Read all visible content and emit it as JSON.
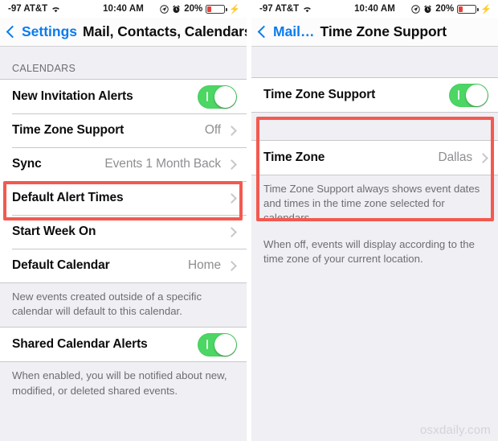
{
  "status_bar": {
    "carrier": "-97 AT&T",
    "wifi_icon": "wifi-icon",
    "time": "10:40 AM",
    "location_icon": "location-arrow-icon",
    "alarm_icon": "alarm-clock-icon",
    "battery_percent": "20%",
    "battery_level": 20,
    "charging_icon": "lightning-bolt-icon"
  },
  "left_screen": {
    "nav": {
      "back_label": "Settings",
      "back_icon": "chevron-left-icon",
      "title": "Mail, Contacts, Calendars"
    },
    "section_header": "CALENDARS",
    "rows": [
      {
        "label": "New Invitation Alerts",
        "control": "toggle",
        "toggle_on": true
      },
      {
        "label": "Time Zone Support",
        "value": "Off",
        "control": "disclosure",
        "highlighted": true
      },
      {
        "label": "Sync",
        "value": "Events 1 Month Back",
        "control": "disclosure"
      },
      {
        "label": "Default Alert Times",
        "value": "",
        "control": "disclosure"
      },
      {
        "label": "Start Week On",
        "value": "",
        "control": "disclosure"
      },
      {
        "label": "Default Calendar",
        "value": "Home",
        "control": "disclosure"
      }
    ],
    "footnote_1": "New events created outside of a specific calendar will default to this calendar.",
    "shared_row": {
      "label": "Shared Calendar Alerts",
      "control": "toggle",
      "toggle_on": true
    },
    "footnote_2": "When enabled, you will be notified about new, modified, or deleted shared events."
  },
  "right_screen": {
    "nav": {
      "back_label": "Mail…",
      "back_icon": "chevron-left-icon",
      "title": "Time Zone Support"
    },
    "row_support": {
      "label": "Time Zone Support",
      "control": "toggle",
      "toggle_on": true
    },
    "row_zone": {
      "label": "Time Zone",
      "value": "Dallas",
      "control": "disclosure"
    },
    "footnote_1": "Time Zone Support always shows event dates and times in the time zone selected for calendars.",
    "footnote_2": "When off, events will display according to the time zone of your current location."
  },
  "watermark": "osxdaily.com",
  "colors": {
    "accent_blue": "#0a7bf0",
    "toggle_green": "#4CD663",
    "highlight_red": "#F4594F",
    "background_gray": "#EFEFF4",
    "value_gray": "#8e8e93"
  }
}
